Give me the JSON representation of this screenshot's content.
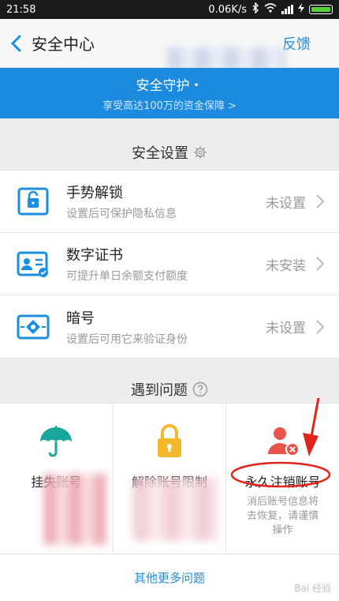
{
  "status": {
    "time": "21:58",
    "speed": "0.06K/s"
  },
  "nav": {
    "title": "安全中心",
    "feedback": "反馈"
  },
  "banner": {
    "line1": "安全守护・",
    "line2": "享受高达100万的资金保障 >"
  },
  "settings": {
    "header": "安全设置",
    "items": [
      {
        "title": "手势解锁",
        "desc": "设置后可保护隐私信息",
        "status": "未设置",
        "icon": "gesture-lock-icon"
      },
      {
        "title": "数字证书",
        "desc": "可提升单日余额支付额度",
        "status": "未安装",
        "icon": "digital-certificate-icon"
      },
      {
        "title": "暗号",
        "desc": "设置后可用它来验证身份",
        "status": "未设置",
        "icon": "password-code-icon"
      }
    ]
  },
  "problems": {
    "header": "遇到问题",
    "items": [
      {
        "label": "挂失账号",
        "icon": "umbrella-icon"
      },
      {
        "label": "解除账号限制",
        "icon": "unlock-icon"
      },
      {
        "label": "永久注销账号",
        "icon": "delete-user-icon",
        "desc_line1": "消后账号信息将",
        "desc_line2": "去恢复，请谨慎",
        "desc_line3": "操作"
      }
    ]
  },
  "more_problems": "其他更多问题",
  "watermark": "Bai 经验"
}
